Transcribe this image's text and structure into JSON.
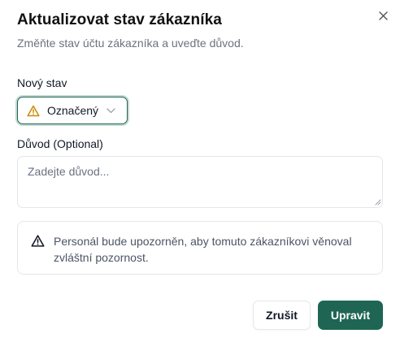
{
  "dialog": {
    "title": "Aktualizovat stav zákazníka",
    "subtitle": "Změňte stav účtu zákazníka a uveďte důvod.",
    "close_icon": "close-icon"
  },
  "status_field": {
    "label": "Nový stav",
    "selected_value": "Označený",
    "selected_icon": "warning-triangle-icon",
    "selected_icon_color": "#ca8a04",
    "dropdown_icon": "chevron-down-icon"
  },
  "reason_field": {
    "label": "Důvod (Optional)",
    "placeholder": "Zadejte důvod...",
    "value": ""
  },
  "notice": {
    "icon": "warning-triangle-icon",
    "text": "Personál bude upozorněn, aby tomuto zákazníkovi věnoval zvláštní pozornost."
  },
  "actions": {
    "cancel_label": "Zrušit",
    "submit_label": "Upravit"
  },
  "colors": {
    "accent": "#1e6653",
    "warning": "#ca8a04",
    "border": "#e5e7eb",
    "muted_text": "#6b7280"
  }
}
